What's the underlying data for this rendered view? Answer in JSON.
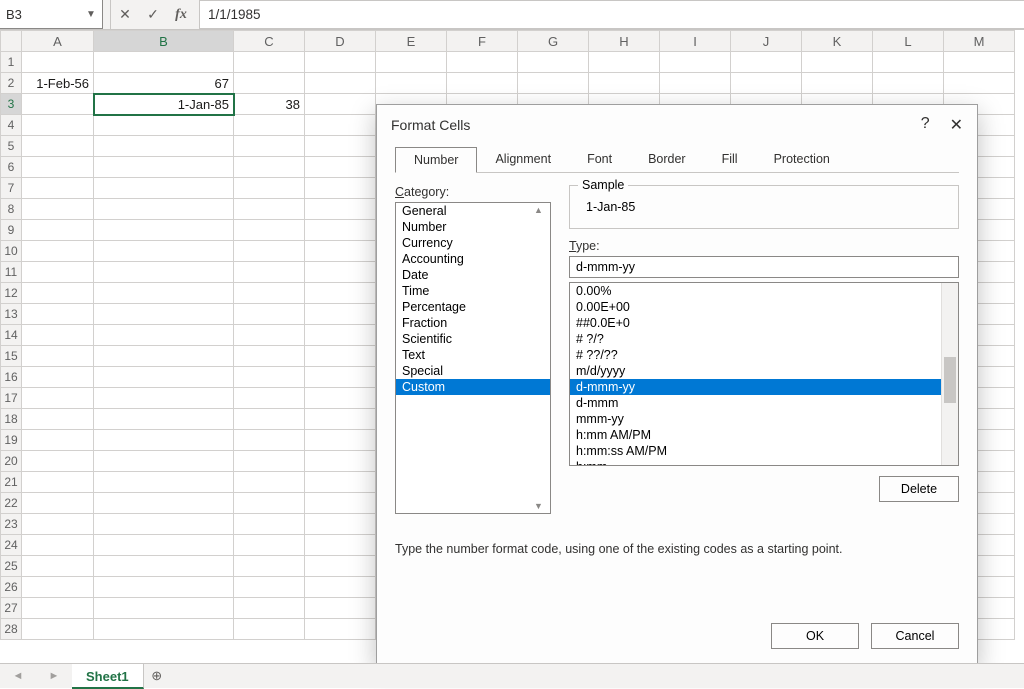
{
  "formula_bar": {
    "name_box": "B3",
    "fx_label": "fx",
    "formula": "1/1/1985"
  },
  "grid": {
    "columns": [
      "A",
      "B",
      "C",
      "D",
      "E",
      "F",
      "G",
      "H",
      "I",
      "J",
      "K",
      "L",
      "M"
    ],
    "rows": 28,
    "selected_col": "B",
    "selected_row": 3,
    "cells": {
      "A2": "1-Feb-56",
      "B2": "67",
      "B3": "1-Jan-85",
      "C3": "38"
    }
  },
  "sheet_tabs": {
    "active": "Sheet1",
    "add_icon": "⊕"
  },
  "dialog": {
    "title": "Format Cells",
    "help_icon": "?",
    "close_icon": "✕",
    "tabs": [
      "Number",
      "Alignment",
      "Font",
      "Border",
      "Fill",
      "Protection"
    ],
    "active_tab": "Number",
    "category_label": "Category:",
    "categories": [
      "General",
      "Number",
      "Currency",
      "Accounting",
      "Date",
      "Time",
      "Percentage",
      "Fraction",
      "Scientific",
      "Text",
      "Special",
      "Custom"
    ],
    "category_selected": "Custom",
    "sample_label": "Sample",
    "sample_value": "1-Jan-85",
    "type_label": "Type:",
    "type_value": "d-mmm-yy",
    "type_list": [
      "0.00%",
      "0.00E+00",
      "##0.0E+0",
      "# ?/?",
      "# ??/??",
      "m/d/yyyy",
      "d-mmm-yy",
      "d-mmm",
      "mmm-yy",
      "h:mm AM/PM",
      "h:mm:ss AM/PM",
      "h:mm"
    ],
    "type_selected": "d-mmm-yy",
    "delete_btn": "Delete",
    "hint": "Type the number format code, using one of the existing codes as a starting point.",
    "ok_btn": "OK",
    "cancel_btn": "Cancel"
  }
}
